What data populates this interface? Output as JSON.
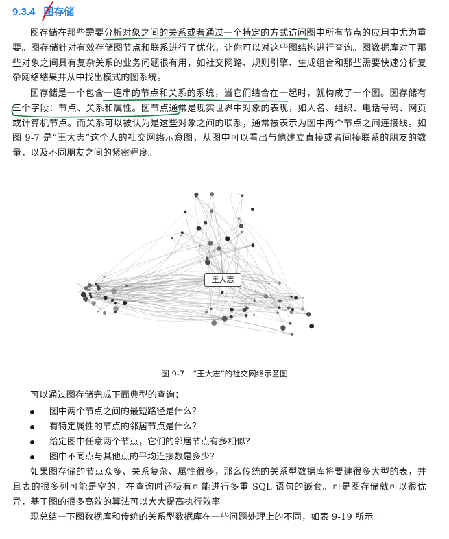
{
  "heading": {
    "number": "9.3.4",
    "title": "图存储"
  },
  "paragraphs": [
    "图存储在那些需要分析对象之间的关系或者通过一个特定的方式访问图中所有节点的应用中尤为重要。图存储针对有效存储图节点和联系进行了优化，让你可以对这些图结构进行查询。图数据库对于那些对象之间具有复杂关系的业务问题很有用，如社交网路、规则引擎、生成组合和那些需要快速分析复杂网络结果并从中找出模式的图系统。",
    "图存储是一个包含一连串的节点和关系的系统，当它们结合在一起时，就构成了一个图。图存储有三个字段：节点、关系和属性。图节点通常是现实世界中对象的表现，如人名、组织、电话号码、网页或计算机节点。而关系可以被认为是这些对象之间的联系，通常被表示为图中两个节点之间连接线。如图 9-7 是“王大志”这个人的社交网络示意图，从图中可以看出与他建立直接或者间接联系的朋友的数量，以及不同朋友之间的紧密程度。"
  ],
  "figure": {
    "center_label": "王大志",
    "caption_number": "图 9-7",
    "caption_text": "“王大志”的社交网络示意图"
  },
  "intro_queries": "可以通过图存储完成下面典型的查询：",
  "queries": [
    "图中两个节点之间的最短路径是什么？",
    "有特定属性的节点的邻居节点是什么？",
    "给定图中任意两个节点，它们的邻居节点有多相似？",
    "图中不同点与其他点的平均连接数是多少？"
  ],
  "closing_paragraphs": [
    "如果图存储的节点众多、关系复杂、属性很多，那么传统的关系型数据库将要建很多大型的表，并且表的很多列可能是空的，在查询时还极有可能进行多重 SQL 语句的嵌套。可是图存储就可以很优异，基于图的很多高效的算法可以大大提高执行效率。",
    "现总结一下图数据库和传统的关系型数据库在一些问题处理上的不同，如表 9-19 所示。"
  ],
  "colors": {
    "heading": "#2a7fd0",
    "annotation": "#1f7a4a",
    "annotation_red": "#d0203a"
  }
}
